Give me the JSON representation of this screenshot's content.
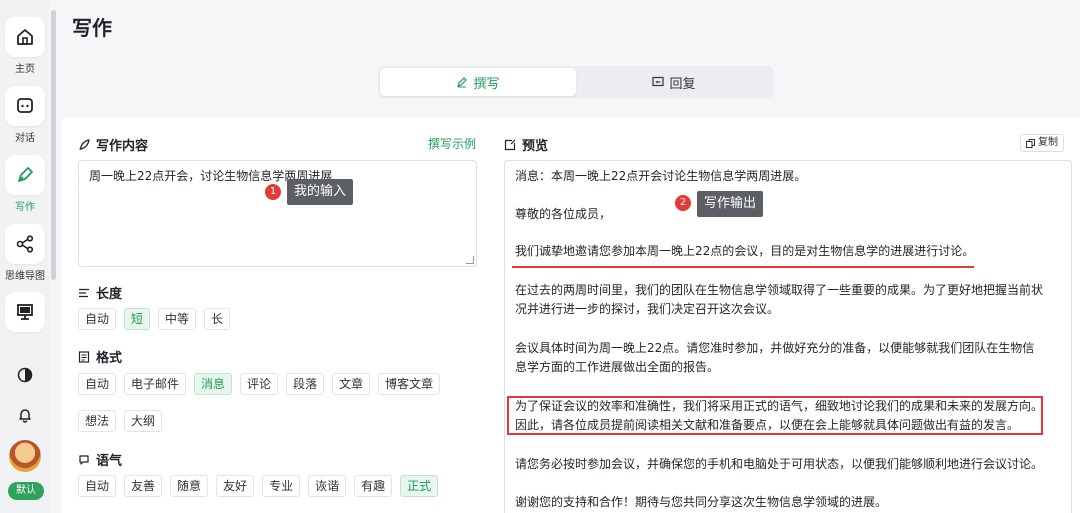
{
  "sidebar": {
    "items": [
      {
        "label": "主页",
        "icon": "home-icon"
      },
      {
        "label": "对话",
        "icon": "chat-icon"
      },
      {
        "label": "写作",
        "icon": "pen-icon"
      },
      {
        "label": "思维导图",
        "icon": "mindmap-icon"
      },
      {
        "label": "",
        "icon": "monitor-icon"
      }
    ],
    "utilities": [
      "theme-toggle-icon",
      "bell-icon"
    ],
    "default_tag": "默认"
  },
  "header": {
    "title": "写作"
  },
  "tabs": [
    {
      "label": "撰写",
      "icon": "edit-icon",
      "active": true
    },
    {
      "label": "回复",
      "icon": "reply-icon",
      "active": false
    }
  ],
  "left": {
    "content_title": "写作内容",
    "examples_link": "撰写示例",
    "input_value": "周一晚上22点开会，讨论生物信息学两周进展",
    "length": {
      "title": "长度",
      "options": [
        "自动",
        "短",
        "中等",
        "长"
      ],
      "selected": "短"
    },
    "format": {
      "title": "格式",
      "options_row1": [
        "自动",
        "电子邮件",
        "消息",
        "评论",
        "段落",
        "文章",
        "博客文章"
      ],
      "options_row2": [
        "想法",
        "大纲"
      ],
      "selected": "消息"
    },
    "tone": {
      "title": "语气",
      "options": [
        "自动",
        "友善",
        "随意",
        "友好",
        "专业",
        "诙谐",
        "有趣",
        "正式"
      ],
      "selected": "正式"
    }
  },
  "right": {
    "preview_title": "预览",
    "copy_label": "复制",
    "paragraphs": [
      "消息：本周一晚上22点开会讨论生物信息学两周进展。",
      "尊敬的各位成员，",
      "我们诚挚地邀请您参加本周一晚上22点的会议，目的是对生物信息学的进展进行讨论。",
      "在过去的两周时间里，我们的团队在生物信息学领域取得了一些重要的成果。为了更好地把握当前状",
      "况并进行进一步的探讨，我们决定召开这次会议。",
      "会议具体时间为周一晚上22点。请您准时参加，并做好充分的准备，以便能够就我们团队在生物信",
      "息学方面的工作进展做出全面的报告。",
      "为了保证会议的效率和准确性，我们将采用正式的语气，细致地讨论我们的成果和未来的发展方向。",
      "因此，请各位成员提前阅读相关文献和准备要点，以便在会上能够就具体问题做出有益的发言。",
      "请您务必按时参加会议，并确保您的手机和电脑处于可用状态，以便我们能够顺利地进行会议讨论。",
      "谢谢您的支持和合作！期待与您共同分享这次生物信息学领域的进展。"
    ]
  },
  "annotations": [
    {
      "number": "1",
      "text": "我的输入"
    },
    {
      "number": "2",
      "text": "写作输出"
    }
  ],
  "colors": {
    "accent": "#1e9e5a",
    "annotation": "#e53935"
  }
}
